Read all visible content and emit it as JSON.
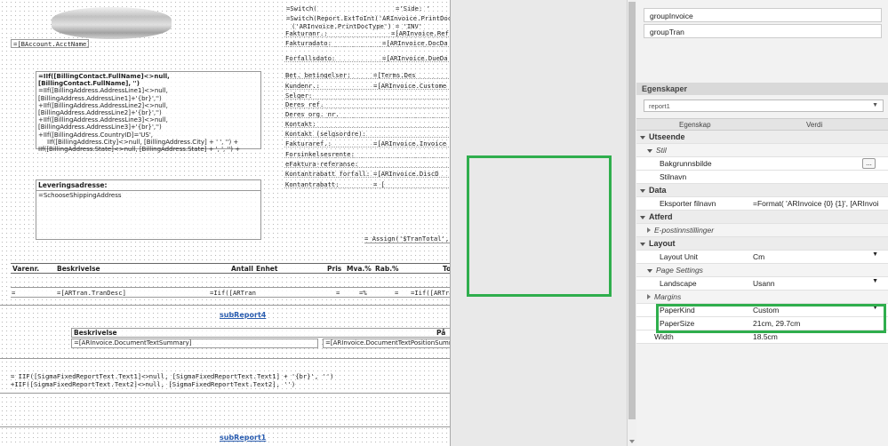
{
  "canvas": {
    "acct_field": "=[BAccount.AcctName]",
    "address_lines": [
      "=IIf([BillingContact.FullName]<>null, [BillingContact.FullName], '')",
      "=IIf([BillingAddress.AddressLine1]<>null,",
      "[BillingAddress.AddressLine1]+'{br}','')",
      "+IIf([BillingAddress.AddressLine2]<>null,",
      "[BillingAddress.AddressLine2]+'{br}','')",
      "+IIf([BillingAddress.AddressLine3]<>null,",
      "[BillingAddress.AddressLine3]+'{br}','')",
      "+IIf([BillingAddress.CountryID]='US',",
      "IIf([BillingAddress.City]<>null, [BillingAddress.City] + ' ', '') +",
      "IIf([BillingAddress.State]<>null, [BillingAddress.State] + ', ', '') +"
    ],
    "shipping_label": "Leveringsadresse:",
    "shipping_field": "=SchooseShippingAddress",
    "switch_line1": "=Switch(",
    "switch_side": "='Side: '",
    "switch_line2": "=Switch(Report.ExtToInt('ARInvoice.PrintDocT",
    "switch_line3": "('ARInvoice.PrintDocType') = 'INV'",
    "right_rows": [
      {
        "label": "Fakturanr.:",
        "value": "=[ARInvoice.Ref"
      },
      {
        "label": "Fakturadato:",
        "value": "=[ARInvoice.DocDa"
      },
      {
        "label": "Forfallsdato:",
        "value": "=[ARInvoice.DueDa"
      }
    ],
    "terms_rows": [
      {
        "label": "Bet. betingelser:",
        "value": "=[Terms.Des"
      },
      {
        "label": "Kundenr.:",
        "value": "=[ARInvoice.Custome"
      },
      {
        "label": "Selger:",
        "value": ""
      },
      {
        "label": "Deres ref.",
        "value": ""
      },
      {
        "label": "Deres org. nr.",
        "value": ""
      },
      {
        "label": "Kontakt:",
        "value": ""
      },
      {
        "label": "Kontakt (selgsordre):",
        "value": ""
      },
      {
        "label": "Fakturaref.:",
        "value": "=[ARInvoice.Invoice"
      },
      {
        "label": "Forsinkelsesrente:",
        "value": ""
      },
      {
        "label": "eFaktura-referanse:",
        "value": ""
      },
      {
        "label": "Kontantrabatt forfall:",
        "value": "=[ARInvoice.DiscD"
      },
      {
        "label": "Kontantrabatt:",
        "value": "= ["
      }
    ],
    "assign_field": "= Assign('$TranTotal',",
    "table_headers": [
      "Varenr.",
      "Beskrivelse",
      "Antall",
      "Enhet",
      "Pris",
      "Mva.%",
      "Rab.%",
      "To"
    ],
    "row_fields": [
      "=",
      "=[ARTran.TranDesc]",
      "=Iif([ARTran",
      "=",
      "=%",
      "=",
      "=Iif([ARTran"
    ],
    "subreport4": "subReport4",
    "desc_header": "Beskrivelse",
    "desc_header2": "På",
    "desc_field": "=[ARInvoice.DocumentTextSummary]",
    "desc_field2": "=[ARInvoice.DocumentTextPositionSumm",
    "sigma_line1": "= IIF([SigmaFixedReportText.Text1]<>null, [SigmaFixedReportText.Text1] + '{br}', '')",
    "sigma_line2": "+IIF([SigmaFixedReportText.Text2]<>null, [SigmaFixedReportText.Text2], '')",
    "subreport1": "subReport1"
  },
  "groups": [
    "groupInvoice",
    "groupTran"
  ],
  "properties": {
    "title": "Egenskaper",
    "selected_object": "report1",
    "col_property": "Egenskap",
    "col_value": "Verdi",
    "rows": [
      {
        "type": "cat",
        "key": "Utseende"
      },
      {
        "type": "sub",
        "key": "Stil"
      },
      {
        "type": "prop",
        "key": "Bakgrunnsbilde",
        "value": ""
      },
      {
        "type": "prop",
        "key": "Stilnavn",
        "value": ""
      },
      {
        "type": "cat",
        "key": "Data"
      },
      {
        "type": "prop",
        "key": "Eksporter filnavn",
        "value": "=Format( 'ARInvoice {0} {1}', [ARInvoi"
      },
      {
        "type": "cat",
        "key": "Atferd"
      },
      {
        "type": "sub",
        "key": "E-postinnstillinger"
      },
      {
        "type": "cat",
        "key": "Layout"
      },
      {
        "type": "prop",
        "key": "Layout Unit",
        "value": "Cm"
      },
      {
        "type": "sub",
        "key": "Page Settings"
      },
      {
        "type": "prop",
        "key": "Landscape",
        "value": "Usann"
      },
      {
        "type": "sub",
        "key": "Margins"
      },
      {
        "type": "prop",
        "key": "PaperKind",
        "value": "Custom"
      },
      {
        "type": "prop",
        "key": "PaperSize",
        "value": "21cm, 29.7cm"
      },
      {
        "type": "prop",
        "key": "Width",
        "value": "18.5cm"
      }
    ],
    "ellipsis": "..."
  },
  "colors": {
    "highlight": "#2fae4d",
    "link": "#2a5db0"
  }
}
